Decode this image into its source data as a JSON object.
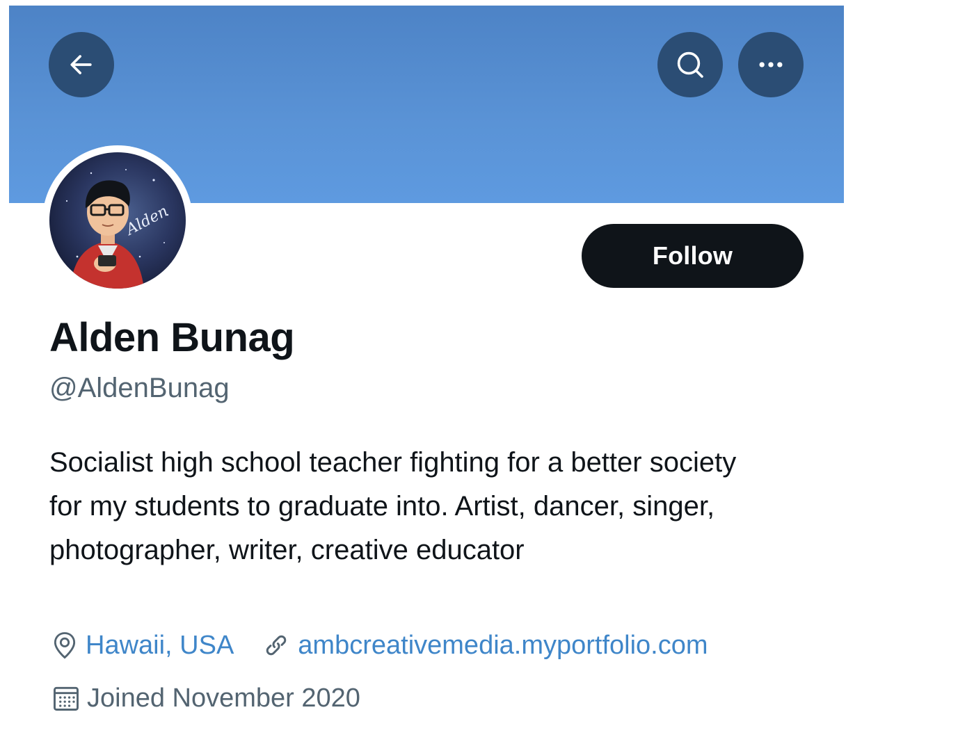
{
  "header": {
    "back_icon": "arrow-left-icon",
    "search_icon": "search-icon",
    "more_icon": "more-horizontal-icon",
    "banner_color": "#5a93d6",
    "button_color": "#2b4d74"
  },
  "profile": {
    "avatar_signature": "Alden",
    "follow_label": "Follow",
    "display_name": "Alden Bunag",
    "handle": "@AldenBunag",
    "bio": "Socialist high school teacher fighting for a better society for my students to graduate into. Artist, dancer, singer, photographer, writer, creative educator",
    "location": "Hawaii, USA",
    "website": "ambcreativemedia.myportfolio.com",
    "joined": "Joined November 2020",
    "link_color": "#3f86c9"
  }
}
